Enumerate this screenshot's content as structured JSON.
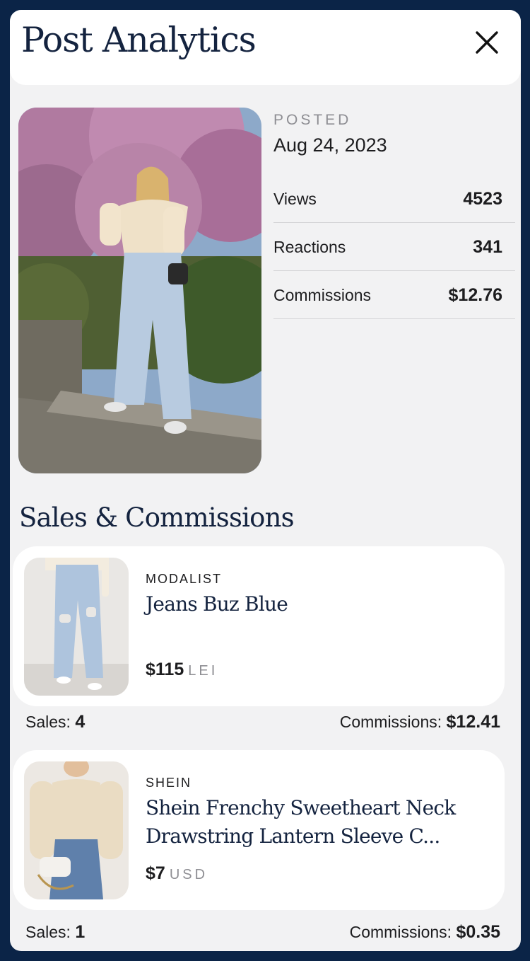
{
  "header": {
    "title": "Post Analytics",
    "close_icon": "close-icon"
  },
  "post": {
    "posted_label": "POSTED",
    "posted_date": "Aug 24, 2023",
    "stats": [
      {
        "label": "Views",
        "value": "4523"
      },
      {
        "label": "Reactions",
        "value": "341"
      },
      {
        "label": "Commissions",
        "value": "$12.76"
      }
    ]
  },
  "sales": {
    "section_title": "Sales & Commissions",
    "items": [
      {
        "brand": "MODALIST",
        "name": "Jeans Buz Blue",
        "price": "$115",
        "currency": "LEI",
        "sales_label": "Sales:",
        "sales_value": "4",
        "commissions_label": "Commissions:",
        "commissions_value": "$12.41"
      },
      {
        "brand": "SHEIN",
        "name": "Shein Frenchy Sweetheart Neck Drawstring Lantern Sleeve C...",
        "price": "$7",
        "currency": "USD",
        "sales_label": "Sales:",
        "sales_value": "1",
        "commissions_label": "Commissions:",
        "commissions_value": "$0.35"
      }
    ]
  },
  "colors": {
    "frame": "#0b2447",
    "panel": "#f2f2f3",
    "title": "#14233f",
    "muted": "#8e8e93"
  }
}
